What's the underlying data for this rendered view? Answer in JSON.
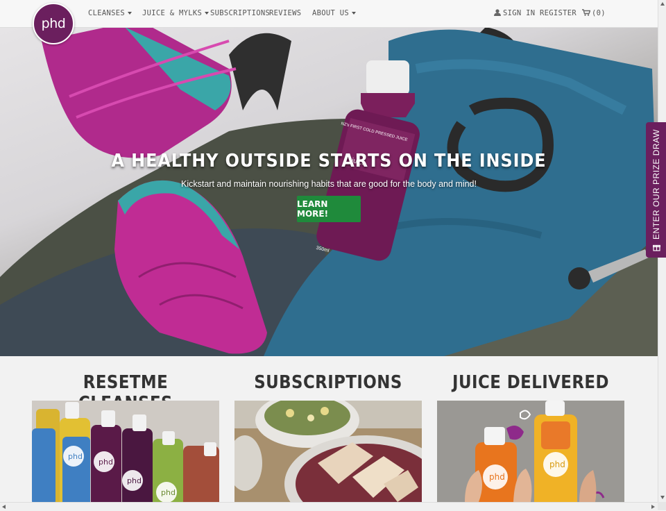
{
  "brand": {
    "logo_text": "phd",
    "accent": "#6b1f5e",
    "button_green": "#1f8a3b"
  },
  "nav": {
    "items": [
      {
        "label": "Cleanses",
        "dropdown": true
      },
      {
        "label": "Juice & Mylks",
        "dropdown": true
      },
      {
        "label": "Subscriptions",
        "dropdown": false
      },
      {
        "label": "Reviews",
        "dropdown": false
      },
      {
        "label": "About Us",
        "dropdown": true
      }
    ],
    "sign_in": "Sign In",
    "register": "Register",
    "cart": "(0)",
    "icons": {
      "sign_in": "user-icon",
      "cart": "cart-icon"
    }
  },
  "hero": {
    "title": "A HEALTHY OUTSIDE STARTS ON THE INSIDE",
    "subtitle": "Kickstart and maintain nourishing habits that are good for the body and mind!",
    "button": "Learn More!",
    "bottle_label_top": "NZ's FIRST COLD PRESSED JUICE",
    "bottle_brand": "juice",
    "bottle_size": "350ml"
  },
  "prize_tab": {
    "label": "ENTER OUR PRIZE DRAW",
    "icon": "gift-icon"
  },
  "features": [
    {
      "title": "RESETME CLEANSES",
      "bottle_brand": "phd"
    },
    {
      "title": "SUBSCRIPTIONS"
    },
    {
      "title": "JUICE DELIVERED",
      "bottle_brand": "phd"
    }
  ]
}
